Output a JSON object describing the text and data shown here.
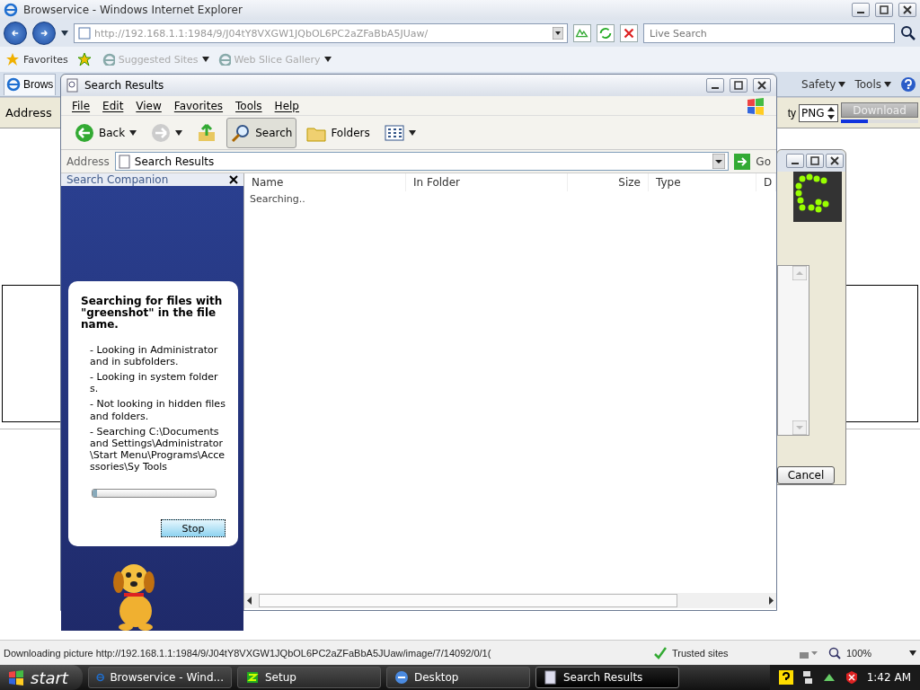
{
  "browser": {
    "title": "Browservice - Windows Internet Explorer",
    "url": "http://192.168.1.1:1984/9/J04tY8VXGW1JQbOL6PC2aZFaBbA5JUaw/",
    "search_placeholder": "Live Search",
    "favorites_label": "Favorites",
    "favorites": [
      "Suggested Sites",
      "Web Slice Gallery"
    ],
    "tab": "Brows",
    "commands": [
      "Safety",
      "Tools"
    ],
    "page": {
      "address_label": "Address",
      "quality_label": "ty",
      "format": "PNG",
      "download": "Download",
      "level": 0.35
    },
    "status": "Downloading picture http://192.168.1.1:1984/9/J04tY8VXGW1JQbOL6PC2aZFaBbA5JUaw/image/7/14092/0/1(",
    "zone": "Trusted sites",
    "zoom": "100%"
  },
  "setup_window": {
    "cancel": "Cancel"
  },
  "explorer": {
    "title": "Search Results",
    "menu": [
      "File",
      "Edit",
      "View",
      "Favorites",
      "Tools",
      "Help"
    ],
    "toolbar": [
      {
        "kind": "back",
        "label": "Back",
        "selected": false
      },
      {
        "kind": "forward",
        "selected": false
      },
      {
        "kind": "up",
        "selected": false
      },
      {
        "kind": "search",
        "label": "Search",
        "selected": true
      },
      {
        "kind": "folders",
        "label": "Folders",
        "selected": false
      },
      {
        "kind": "views",
        "selected": false
      }
    ],
    "address_label": "Address",
    "address": "Search Results",
    "go": "Go",
    "companion": {
      "title": "Search Companion",
      "heading": "Searching for files with \"greenshot\" in the file name.",
      "lines": [
        "- Looking in Administrator and in subfolders.",
        "- Looking in system folders.",
        "- Not looking in hidden files and folders.",
        "- Searching C:\\Documents and Settings\\Administrator\\Start Menu\\Programs\\Accessories\\Sy Tools"
      ],
      "level": 0.04,
      "stop": "Stop"
    },
    "columns": [
      "Name",
      "In Folder",
      "Size",
      "Type",
      "D"
    ],
    "status_text": "Searching.."
  },
  "taskbar": {
    "start": "start",
    "tasks": [
      {
        "label": "Browservice - Wind...",
        "selected": false
      },
      {
        "label": "Setup",
        "selected": false
      },
      {
        "label": "Desktop",
        "selected": false
      },
      {
        "label": "Search Results",
        "selected": true
      }
    ],
    "clock": "1:42 AM"
  }
}
